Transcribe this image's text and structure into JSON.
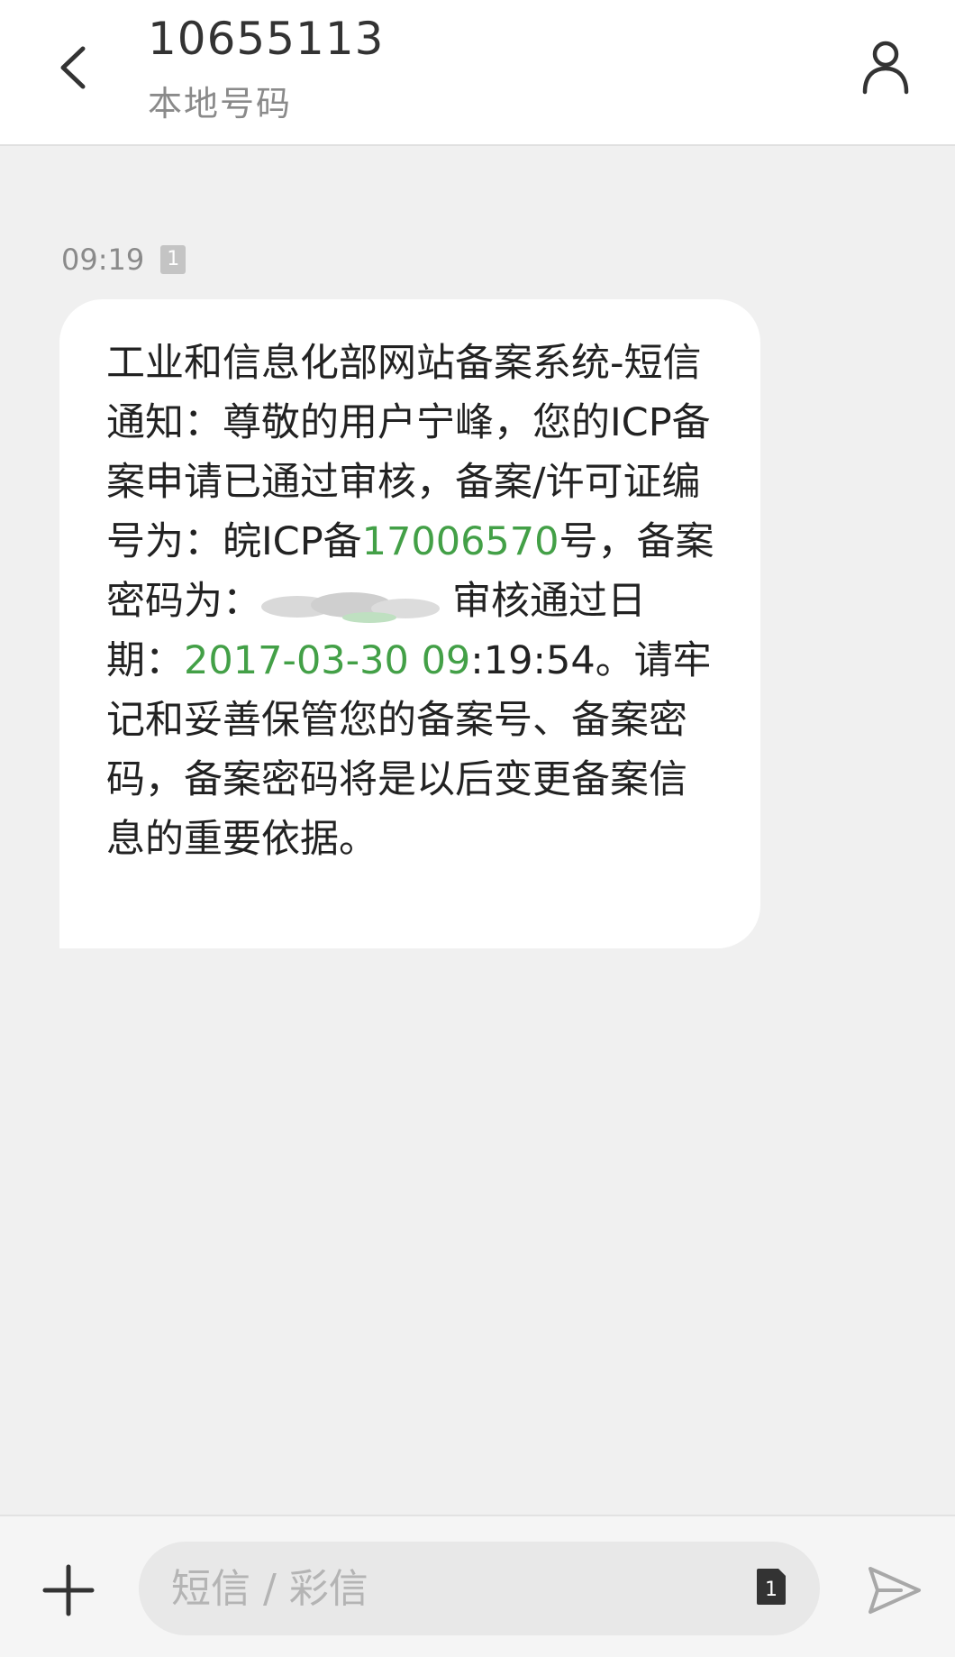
{
  "header": {
    "number": "10655113",
    "subtitle": "本地号码"
  },
  "icons": {
    "back": "chevron-left-icon",
    "contact": "person-icon",
    "sim": "sim-1-icon",
    "add": "plus-icon",
    "send": "send-icon"
  },
  "message": {
    "time": "09:19",
    "sim_label": "1",
    "segments": [
      {
        "text": "工业和信息化部网站备案系统-短信通知：尊敬的用户宁峰，您的ICP备案申请已通过审核，备案/许可证编号为：皖ICP备",
        "link": false
      },
      {
        "text": "17006570",
        "link": true
      },
      {
        "text": "号，备案密码为：",
        "link": false
      },
      {
        "text": "审核通过日期：",
        "link": false
      },
      {
        "text": "2017-03-30 09",
        "link": true
      },
      {
        "text": ":19:54。请牢记和妥善保管您的备案号、备案密码，备案密码将是以后变更备案信息的重要依据。",
        "link": false
      }
    ]
  },
  "composer": {
    "placeholder": "短信 / 彩信",
    "sim_label": "1"
  },
  "colors": {
    "link": "#43a047",
    "background": "#f0f0f0",
    "bubble": "#ffffff"
  }
}
